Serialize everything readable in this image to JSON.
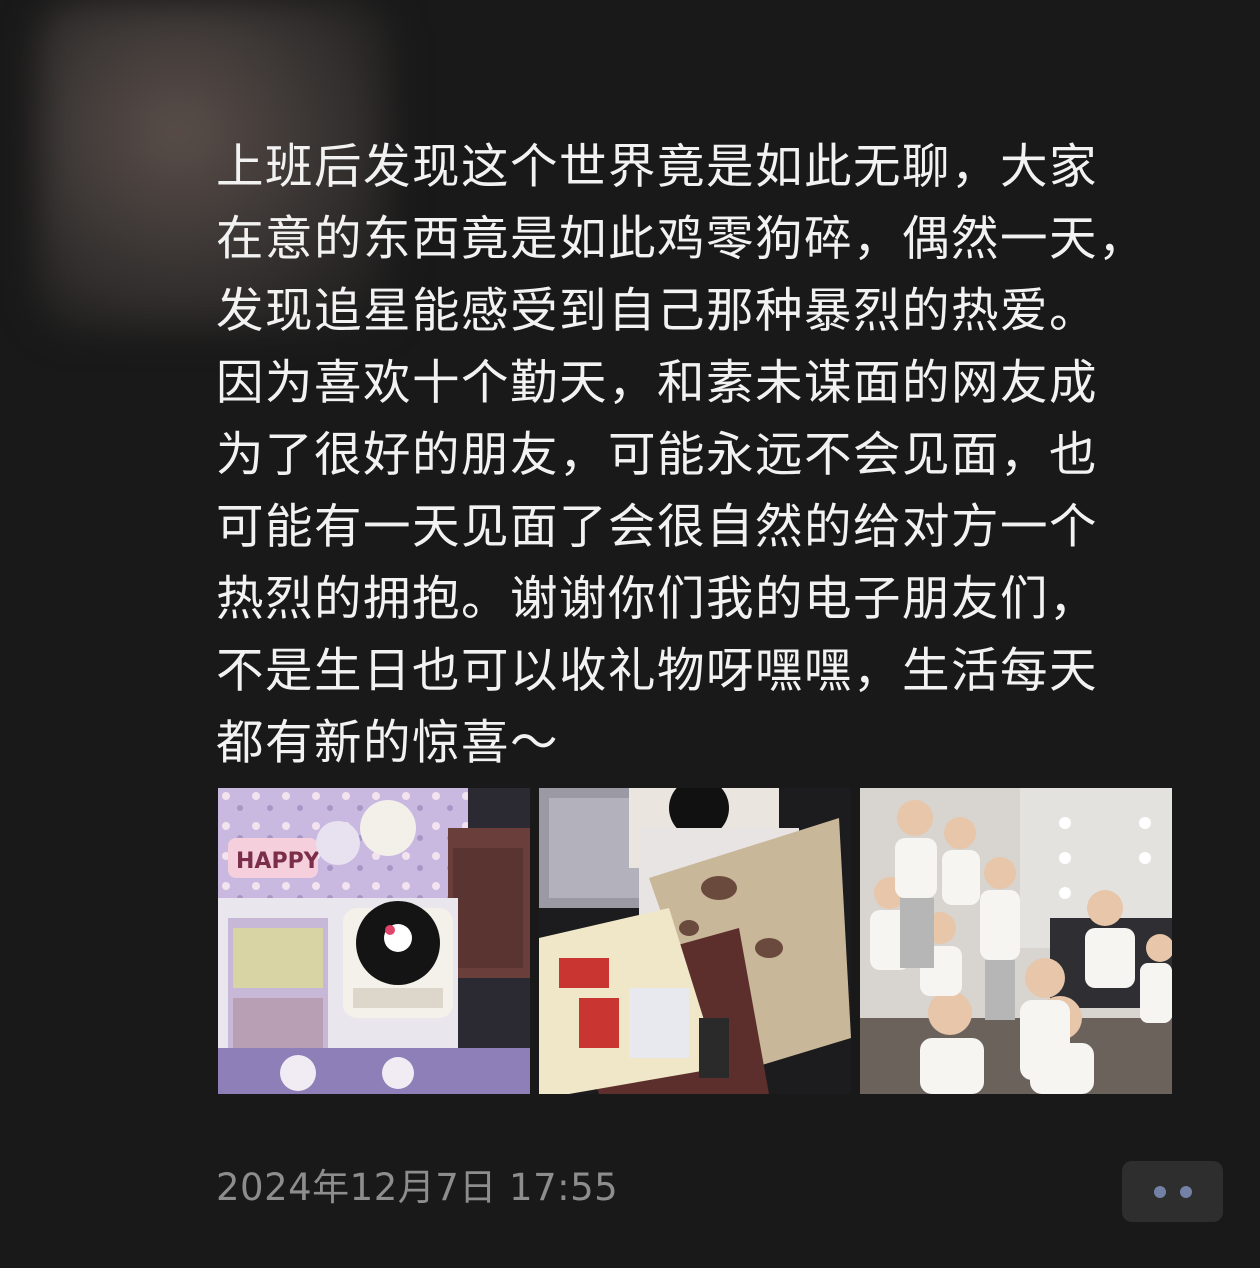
{
  "post": {
    "text_lines": [
      "上班后发现这个世界竟是如此无聊，大家",
      "在意的东西竟是如此鸡零狗碎，偶然一天，",
      "发现追星能感受到自己那种暴烈的热爱。",
      "因为喜欢十个勤天，和素未谋面的网友成",
      "为了很好的朋友，可能永远不会见面，也",
      "可能有一天见面了会很自然的给对方一个",
      "热烈的拥抱。谢谢你们我的电子朋友们，",
      "不是生日也可以收礼物呀嘿嘿，生活每天",
      "都有新的惊喜～"
    ],
    "timestamp": "2024年12月7日 17:55"
  },
  "photos": [
    {
      "name": "gift-box-photo",
      "thumb_text": "HAPPY"
    },
    {
      "name": "gift-cards-photo"
    },
    {
      "name": "group-photo"
    }
  ],
  "actions": {
    "more_icon": "more-dots-icon"
  },
  "colors": {
    "background": "#191919",
    "text": "#f2f2f2",
    "timestamp": "#8d8d8d",
    "action_bg": "#2e2e2e",
    "action_dots": "#7381a6"
  }
}
